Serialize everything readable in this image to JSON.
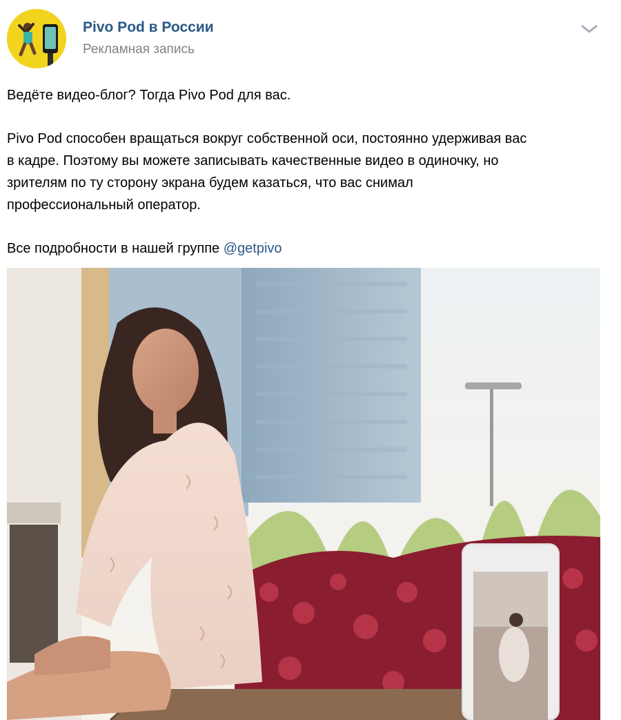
{
  "post": {
    "author": "Pivo Pod в России",
    "subtitle": "Рекламная запись",
    "menu_icon": "chevron-down-icon",
    "paragraph1": "Ведёте видео-блог? Тогда Pivo Pod для вас.",
    "paragraph2_lines": [
      "Pivo Pod способен вращаться вокруг собственной оси, постоянно удерживая вас",
      "в кадре. Поэтому вы можете записывать качественные видео в одиночку, но",
      "зрителям по ту сторону экрана будем казаться, что вас снимал",
      "профессиональный оператор."
    ],
    "paragraph3": "Все подробности в нашей группе ",
    "mention": "@getpivo"
  },
  "colors": {
    "link": "#2a5885",
    "secondary_text": "#828282",
    "avatar_bg": "#f1d21e"
  }
}
